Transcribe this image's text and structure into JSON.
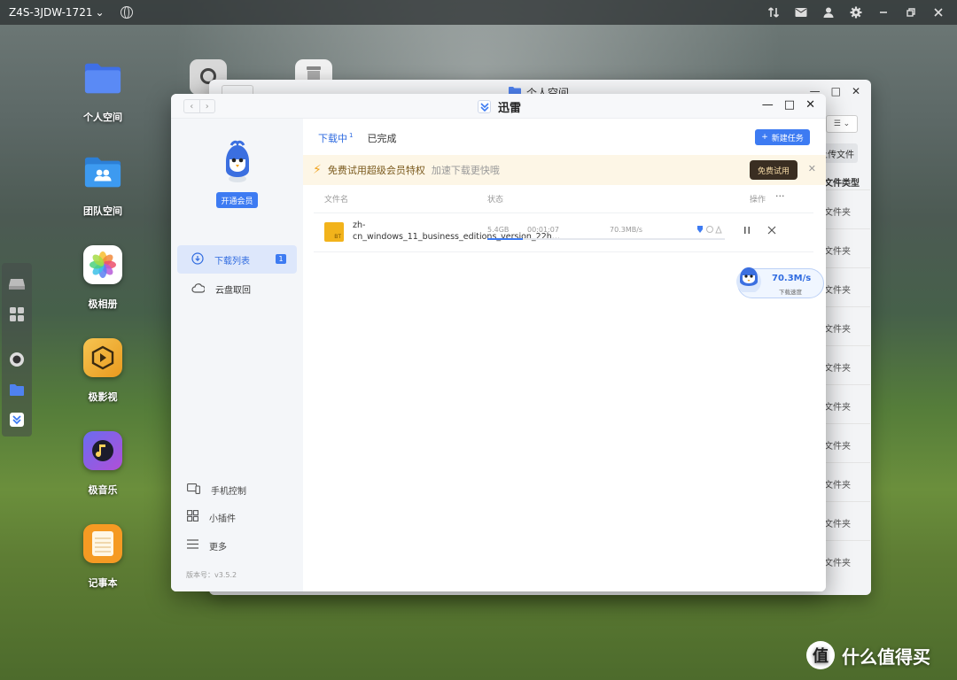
{
  "topbar": {
    "device_name": "Z4S-3JDW-1721",
    "chevron": "⌄"
  },
  "desktop": {
    "icons": [
      {
        "label": "个人空间"
      },
      {
        "label": "团队空间"
      },
      {
        "label": "极相册"
      },
      {
        "label": "极影视"
      },
      {
        "label": "极音乐"
      },
      {
        "label": "记事本"
      }
    ]
  },
  "bg_window": {
    "title": "个人空间",
    "button_label": "上传文件",
    "column_header": "文件类型",
    "row_value": "文件夹"
  },
  "window": {
    "title": "迅雷",
    "sidebar": {
      "vip_button": "开通会员",
      "items": [
        {
          "label": "下载列表",
          "badge": "1"
        },
        {
          "label": "云盘取回"
        }
      ],
      "bottom_items": [
        {
          "label": "手机控制"
        },
        {
          "label": "小插件"
        },
        {
          "label": "更多"
        }
      ],
      "version": "版本号：v3.5.2"
    },
    "tabs": {
      "downloading": "下载中",
      "downloading_count": "1",
      "completed": "已完成"
    },
    "new_task_label": "新建任务",
    "promo": {
      "text": "免费试用超级会员特权",
      "subtext": "加速下载更快哦",
      "trial_button": "免费试用"
    },
    "columns": {
      "filename": "文件名",
      "status": "状态",
      "actions": "操作",
      "more": "···"
    },
    "download": {
      "filename": "zh-cn_windows_11_business_editions_version_22h...",
      "file_badge": "BT",
      "size": "5.4GB",
      "time": "00:01:07",
      "speed": "70.3MB/s",
      "progress_pct": 15
    },
    "speed_widget": {
      "speed": "70.3M/s",
      "label": "下载速度"
    }
  },
  "watermark": {
    "text": "什么值得买",
    "logo": "值"
  }
}
